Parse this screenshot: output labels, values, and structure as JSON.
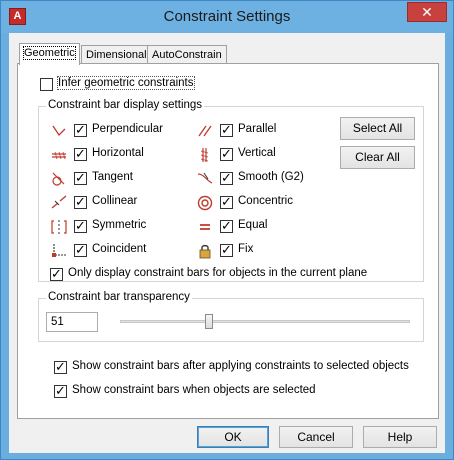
{
  "window": {
    "title": "Constraint Settings",
    "app_icon_glyph": "A",
    "close_glyph": "✕"
  },
  "tabs": [
    {
      "label": "Geometric",
      "active": true
    },
    {
      "label": "Dimensional",
      "active": false
    },
    {
      "label": "AutoConstrain",
      "active": false
    }
  ],
  "infer": {
    "label": "Infer geometric constraints",
    "checked": false
  },
  "bar_group": {
    "title": "Constraint bar display settings"
  },
  "constraints_left": [
    {
      "label": "Perpendicular",
      "icon": "perpendicular-icon",
      "checked": true
    },
    {
      "label": "Horizontal",
      "icon": "horizontal-icon",
      "checked": true
    },
    {
      "label": "Tangent",
      "icon": "tangent-icon",
      "checked": true
    },
    {
      "label": "Collinear",
      "icon": "collinear-icon",
      "checked": true
    },
    {
      "label": "Symmetric",
      "icon": "symmetric-icon",
      "checked": true
    },
    {
      "label": "Coincident",
      "icon": "coincident-icon",
      "checked": true
    }
  ],
  "constraints_right": [
    {
      "label": "Parallel",
      "icon": "parallel-icon",
      "checked": true
    },
    {
      "label": "Vertical",
      "icon": "vertical-icon",
      "checked": true
    },
    {
      "label": "Smooth (G2)",
      "icon": "smooth-icon",
      "checked": true
    },
    {
      "label": "Concentric",
      "icon": "concentric-icon",
      "checked": true
    },
    {
      "label": "Equal",
      "icon": "equal-icon",
      "checked": true
    },
    {
      "label": "Fix",
      "icon": "lock-icon",
      "checked": true
    }
  ],
  "buttons_side": {
    "select_all": "Select All",
    "clear_all": "Clear All"
  },
  "only_current_plane": {
    "label": "Only display constraint bars for objects in the current plane",
    "checked": true
  },
  "transparency": {
    "title": "Constraint bar transparency",
    "value": "51",
    "slider_fraction": 0.51
  },
  "show_after_apply": {
    "label": "Show constraint bars after applying constraints to selected objects",
    "checked": true
  },
  "show_when_selected": {
    "label": "Show constraint bars when objects are selected",
    "checked": true
  },
  "footer": {
    "ok": "OK",
    "cancel": "Cancel",
    "help": "Help"
  },
  "colors": {
    "icon_red": "#c0392b",
    "title_bar": "#6db1e3",
    "close": "#c7413f"
  }
}
